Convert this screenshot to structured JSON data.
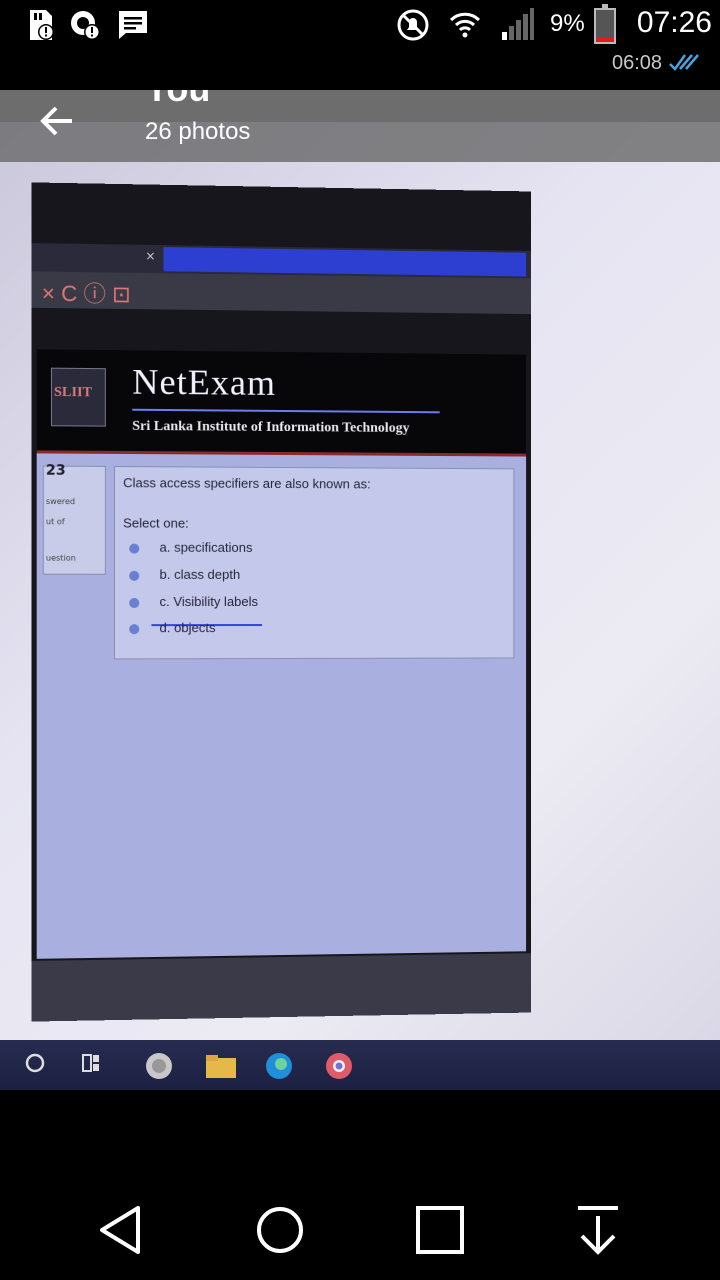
{
  "status_bar": {
    "time": "07:26",
    "battery_percent": "9%",
    "battery_level": 0.09,
    "icons": [
      "sd-card-alert-icon",
      "sync-alert-icon",
      "message-icon",
      "do-not-disturb-icon",
      "wifi-icon",
      "signal-icon",
      "battery-icon"
    ]
  },
  "message_meta": {
    "time": "06:08",
    "status_icon": "double-check-icon"
  },
  "viewer": {
    "title": "You",
    "subtitle": "26 photos",
    "back_icon": "arrow-left-icon"
  },
  "photo": {
    "browser_tab_x": "×",
    "toolbar_glyphs": "× C ⓘ ⊡",
    "logo_text": "SLIIT",
    "site_title": "NetExam",
    "institute": "Sri Lanka Institute of Information Technology",
    "question_number": "23",
    "left_lines": [
      "swered",
      "ut of",
      "uestion"
    ],
    "question": "Class access specifiers are also known as:",
    "select_label": "Select one:",
    "options": [
      {
        "label": "a. specifications"
      },
      {
        "label": "b. class depth"
      },
      {
        "label": "c. Visibility labels"
      },
      {
        "label": "d. objects"
      }
    ],
    "taskbar_icons": [
      "cortana-circle-icon",
      "task-view-icon",
      "browser-globe-icon",
      "file-explorer-icon",
      "edge-icon",
      "chrome-icon"
    ]
  },
  "navigation": {
    "buttons": [
      "back-triangle-icon",
      "home-circle-icon",
      "recents-square-icon",
      "download-arrow-icon"
    ]
  }
}
